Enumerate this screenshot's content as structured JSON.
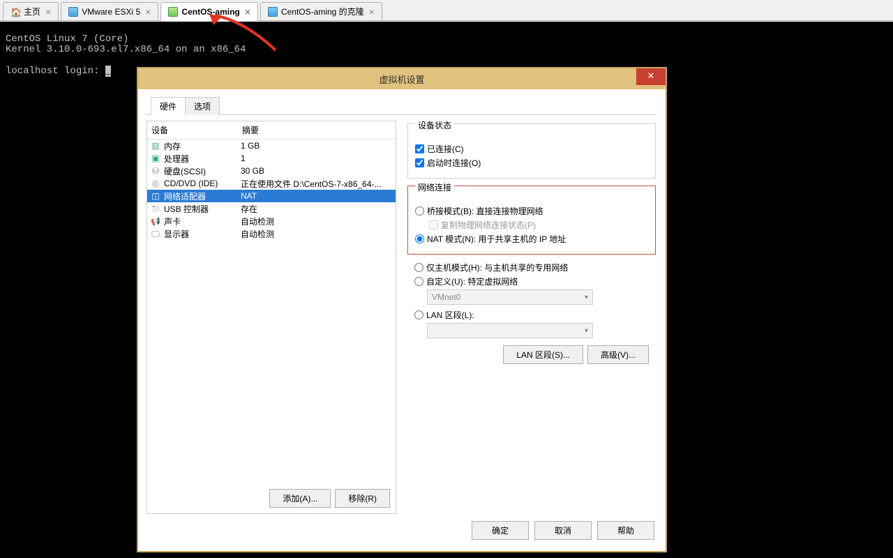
{
  "tabs": [
    {
      "label": "主页",
      "active": false,
      "icon": "home"
    },
    {
      "label": "VMware ESXi 5",
      "active": false,
      "icon": "vm"
    },
    {
      "label": "CentOS-aming",
      "active": true,
      "icon": "vm-on"
    },
    {
      "label": "CentOS-aming 的克隆",
      "active": false,
      "icon": "vm"
    }
  ],
  "terminal": {
    "line1": "CentOS Linux 7 (Core)",
    "line2": "Kernel 3.10.0-693.el7.x86_64 on an x86_64",
    "prompt": "localhost login: "
  },
  "dialog": {
    "title": "虚拟机设置",
    "close": "✕",
    "tabs": {
      "hw": "硬件",
      "opt": "选项"
    },
    "cols": {
      "dev": "设备",
      "sum": "摘要"
    },
    "devices": [
      {
        "icon": "i-mem",
        "name": "内存",
        "sum": "1 GB"
      },
      {
        "icon": "i-cpu",
        "name": "处理器",
        "sum": "1"
      },
      {
        "icon": "i-hd",
        "name": "硬盘(SCSI)",
        "sum": "30 GB"
      },
      {
        "icon": "i-cd",
        "name": "CD/DVD (IDE)",
        "sum": "正在使用文件 D:\\CentOS-7-x86_64-..."
      },
      {
        "icon": "i-net",
        "name": "网络适配器",
        "sum": "NAT",
        "sel": true
      },
      {
        "icon": "i-usb",
        "name": "USB 控制器",
        "sum": "存在"
      },
      {
        "icon": "i-snd",
        "name": "声卡",
        "sum": "自动检测"
      },
      {
        "icon": "i-dsp",
        "name": "显示器",
        "sum": "自动检测"
      }
    ],
    "add": "添加(A)...",
    "remove": "移除(R)",
    "status": {
      "legend": "设备状态",
      "connected": "已连接(C)",
      "onstart": "启动时连接(O)"
    },
    "net": {
      "legend": "网络连接",
      "bridge": "桥接模式(B): 直接连接物理网络",
      "replicate": "复制物理网络连接状态(P)",
      "nat": "NAT 模式(N): 用于共享主机的 IP 地址",
      "host": "仅主机模式(H): 与主机共享的专用网络",
      "custom": "自定义(U): 特定虚拟网络",
      "vmnet": "VMnet0",
      "lan": "LAN 区段(L):"
    },
    "lanseg": "LAN 区段(S)...",
    "adv": "高级(V)...",
    "ok": "确定",
    "cancel": "取消",
    "help": "帮助"
  }
}
